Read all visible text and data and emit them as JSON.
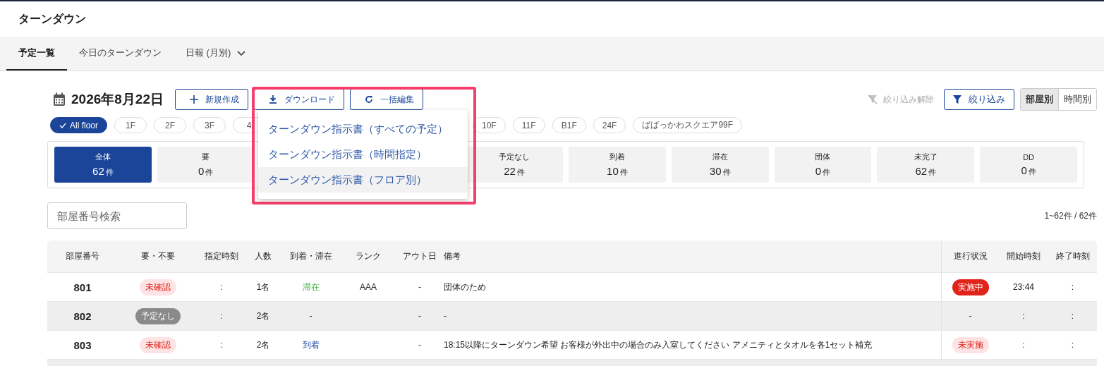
{
  "page_title": "ターンダウン",
  "tabs": [
    {
      "label": "予定一覧",
      "selected": true,
      "dropdown": false
    },
    {
      "label": "今日のターンダウン",
      "selected": false,
      "dropdown": false
    },
    {
      "label": "日報 (月別)",
      "selected": false,
      "dropdown": true
    }
  ],
  "date": "2026年8月22日",
  "actions": [
    "新規作成",
    "ダウンロード",
    "一括編集"
  ],
  "clear_filter": {
    "label": "絞り込み解除",
    "disabled": true
  },
  "filter_button": "絞り込み",
  "view_toggle": [
    {
      "label": "部屋別",
      "selected": true
    },
    {
      "label": "時間別",
      "selected": false
    }
  ],
  "floors_before": [
    {
      "label": "All floor",
      "selected": true
    },
    {
      "label": "1F",
      "selected": false
    },
    {
      "label": "2F",
      "selected": false
    },
    {
      "label": "3F",
      "selected": false
    },
    {
      "label": "4",
      "selected": false
    }
  ],
  "floors_after": [
    {
      "label": "10F",
      "selected": false
    },
    {
      "label": "11F",
      "selected": false
    },
    {
      "label": "B1F",
      "selected": false
    },
    {
      "label": "24F",
      "selected": false
    },
    {
      "label": "ばばっかわスクエア99F",
      "selected": false
    }
  ],
  "stats_before": [
    {
      "label": "全体",
      "count": "62",
      "unit": "件",
      "selected": true
    },
    {
      "label": "要",
      "count": "0",
      "unit": "件",
      "selected": false
    }
  ],
  "stats_after": [
    {
      "label": "予定なし",
      "count": "22",
      "unit": "件",
      "selected": false
    },
    {
      "label": "到着",
      "count": "10",
      "unit": "件",
      "selected": false
    },
    {
      "label": "滞在",
      "count": "30",
      "unit": "件",
      "selected": false
    },
    {
      "label": "団体",
      "count": "0",
      "unit": "件",
      "selected": false
    },
    {
      "label": "未完了",
      "count": "62",
      "unit": "件",
      "selected": false
    },
    {
      "label": "DD",
      "count": "0",
      "unit": "件",
      "selected": false
    }
  ],
  "download_menu": [
    {
      "label": "ターンダウン指示書（すべての予定）",
      "hovered": false
    },
    {
      "label": "ターンダウン指示書（時間指定）",
      "hovered": false
    },
    {
      "label": "ターンダウン指示書（フロア別）",
      "hovered": true
    }
  ],
  "search": {
    "placeholder": "部屋番号検索"
  },
  "result_count": "1~62件 / 62件",
  "table": {
    "columns": [
      "部屋番号",
      "要・不要",
      "指定時刻",
      "人数",
      "到着・滞在",
      "ランク",
      "アウト日",
      "備考",
      "進行状況",
      "開始時刻",
      "終了時刻"
    ],
    "rows": [
      {
        "inactive": false,
        "room": "801",
        "need": {
          "label": "未確認",
          "kind": "unconfirmed"
        },
        "time": ":",
        "guests": "1名",
        "arrival": {
          "label": "滞在",
          "kind": "stay"
        },
        "rank": "AAA",
        "out_date": "-",
        "note": "団体のため",
        "progress": {
          "label": "実施中",
          "kind": "active"
        },
        "start": "23:44",
        "end": ":"
      },
      {
        "inactive": true,
        "room": "802",
        "need": {
          "label": "予定なし",
          "kind": "none"
        },
        "time": ":",
        "guests": "2名",
        "arrival": {
          "label": "-",
          "kind": "plain"
        },
        "rank": "",
        "out_date": "-",
        "note": "-",
        "progress": {
          "label": "-",
          "kind": "plain"
        },
        "start": ":",
        "end": ":"
      },
      {
        "inactive": false,
        "room": "803",
        "need": {
          "label": "未確認",
          "kind": "unconfirmed"
        },
        "time": ":",
        "guests": "2名",
        "arrival": {
          "label": "到着",
          "kind": "arrival"
        },
        "rank": "",
        "out_date": "-",
        "note": "18:15以降にターンダウン希望 お客様が外出中の場合のみ入室してください アメニティとタオルを各1セット補充",
        "progress": {
          "label": "未実施",
          "kind": "pending"
        },
        "start": ":",
        "end": ":"
      }
    ]
  }
}
